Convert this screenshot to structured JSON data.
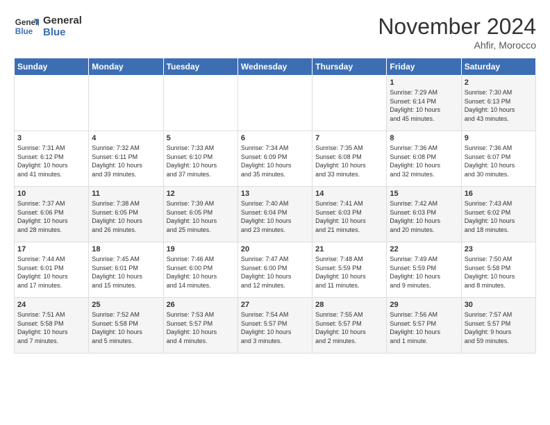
{
  "header": {
    "logo_line1": "General",
    "logo_line2": "Blue",
    "month": "November 2024",
    "location": "Ahfir, Morocco"
  },
  "days_of_week": [
    "Sunday",
    "Monday",
    "Tuesday",
    "Wednesday",
    "Thursday",
    "Friday",
    "Saturday"
  ],
  "weeks": [
    [
      {
        "day": "",
        "info": ""
      },
      {
        "day": "",
        "info": ""
      },
      {
        "day": "",
        "info": ""
      },
      {
        "day": "",
        "info": ""
      },
      {
        "day": "",
        "info": ""
      },
      {
        "day": "1",
        "info": "Sunrise: 7:29 AM\nSunset: 6:14 PM\nDaylight: 10 hours\nand 45 minutes."
      },
      {
        "day": "2",
        "info": "Sunrise: 7:30 AM\nSunset: 6:13 PM\nDaylight: 10 hours\nand 43 minutes."
      }
    ],
    [
      {
        "day": "3",
        "info": "Sunrise: 7:31 AM\nSunset: 6:12 PM\nDaylight: 10 hours\nand 41 minutes."
      },
      {
        "day": "4",
        "info": "Sunrise: 7:32 AM\nSunset: 6:11 PM\nDaylight: 10 hours\nand 39 minutes."
      },
      {
        "day": "5",
        "info": "Sunrise: 7:33 AM\nSunset: 6:10 PM\nDaylight: 10 hours\nand 37 minutes."
      },
      {
        "day": "6",
        "info": "Sunrise: 7:34 AM\nSunset: 6:09 PM\nDaylight: 10 hours\nand 35 minutes."
      },
      {
        "day": "7",
        "info": "Sunrise: 7:35 AM\nSunset: 6:08 PM\nDaylight: 10 hours\nand 33 minutes."
      },
      {
        "day": "8",
        "info": "Sunrise: 7:36 AM\nSunset: 6:08 PM\nDaylight: 10 hours\nand 32 minutes."
      },
      {
        "day": "9",
        "info": "Sunrise: 7:36 AM\nSunset: 6:07 PM\nDaylight: 10 hours\nand 30 minutes."
      }
    ],
    [
      {
        "day": "10",
        "info": "Sunrise: 7:37 AM\nSunset: 6:06 PM\nDaylight: 10 hours\nand 28 minutes."
      },
      {
        "day": "11",
        "info": "Sunrise: 7:38 AM\nSunset: 6:05 PM\nDaylight: 10 hours\nand 26 minutes."
      },
      {
        "day": "12",
        "info": "Sunrise: 7:39 AM\nSunset: 6:05 PM\nDaylight: 10 hours\nand 25 minutes."
      },
      {
        "day": "13",
        "info": "Sunrise: 7:40 AM\nSunset: 6:04 PM\nDaylight: 10 hours\nand 23 minutes."
      },
      {
        "day": "14",
        "info": "Sunrise: 7:41 AM\nSunset: 6:03 PM\nDaylight: 10 hours\nand 21 minutes."
      },
      {
        "day": "15",
        "info": "Sunrise: 7:42 AM\nSunset: 6:03 PM\nDaylight: 10 hours\nand 20 minutes."
      },
      {
        "day": "16",
        "info": "Sunrise: 7:43 AM\nSunset: 6:02 PM\nDaylight: 10 hours\nand 18 minutes."
      }
    ],
    [
      {
        "day": "17",
        "info": "Sunrise: 7:44 AM\nSunset: 6:01 PM\nDaylight: 10 hours\nand 17 minutes."
      },
      {
        "day": "18",
        "info": "Sunrise: 7:45 AM\nSunset: 6:01 PM\nDaylight: 10 hours\nand 15 minutes."
      },
      {
        "day": "19",
        "info": "Sunrise: 7:46 AM\nSunset: 6:00 PM\nDaylight: 10 hours\nand 14 minutes."
      },
      {
        "day": "20",
        "info": "Sunrise: 7:47 AM\nSunset: 6:00 PM\nDaylight: 10 hours\nand 12 minutes."
      },
      {
        "day": "21",
        "info": "Sunrise: 7:48 AM\nSunset: 5:59 PM\nDaylight: 10 hours\nand 11 minutes."
      },
      {
        "day": "22",
        "info": "Sunrise: 7:49 AM\nSunset: 5:59 PM\nDaylight: 10 hours\nand 9 minutes."
      },
      {
        "day": "23",
        "info": "Sunrise: 7:50 AM\nSunset: 5:58 PM\nDaylight: 10 hours\nand 8 minutes."
      }
    ],
    [
      {
        "day": "24",
        "info": "Sunrise: 7:51 AM\nSunset: 5:58 PM\nDaylight: 10 hours\nand 7 minutes."
      },
      {
        "day": "25",
        "info": "Sunrise: 7:52 AM\nSunset: 5:58 PM\nDaylight: 10 hours\nand 5 minutes."
      },
      {
        "day": "26",
        "info": "Sunrise: 7:53 AM\nSunset: 5:57 PM\nDaylight: 10 hours\nand 4 minutes."
      },
      {
        "day": "27",
        "info": "Sunrise: 7:54 AM\nSunset: 5:57 PM\nDaylight: 10 hours\nand 3 minutes."
      },
      {
        "day": "28",
        "info": "Sunrise: 7:55 AM\nSunset: 5:57 PM\nDaylight: 10 hours\nand 2 minutes."
      },
      {
        "day": "29",
        "info": "Sunrise: 7:56 AM\nSunset: 5:57 PM\nDaylight: 10 hours\nand 1 minute."
      },
      {
        "day": "30",
        "info": "Sunrise: 7:57 AM\nSunset: 5:57 PM\nDaylight: 9 hours\nand 59 minutes."
      }
    ]
  ]
}
